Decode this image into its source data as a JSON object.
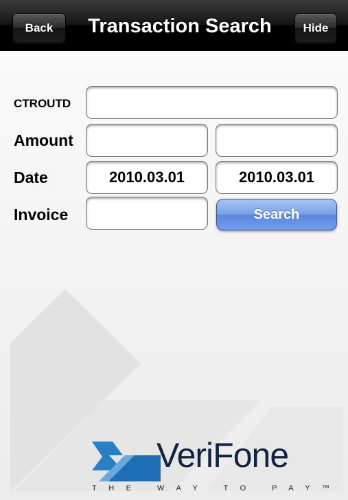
{
  "navbar": {
    "back_label": "Back",
    "title": "Transaction Search",
    "hide_label": "Hide"
  },
  "form": {
    "ctroutd": {
      "label": "CTROUTD",
      "value": ""
    },
    "amount": {
      "label": "Amount",
      "from_value": "",
      "to_value": ""
    },
    "date": {
      "label": "Date",
      "from_value": "2010.03.01",
      "to_value": "2010.03.01"
    },
    "invoice": {
      "label": "Invoice",
      "value": ""
    },
    "search_label": "Search"
  },
  "logo": {
    "name": "VeriFone",
    "tagline": "THE WAY TO PAY™"
  },
  "colors": {
    "navbar": "#000000",
    "search_button": "#6f9bf0",
    "logo_blue": "#2a7fc2",
    "logo_text": "#13233f"
  }
}
